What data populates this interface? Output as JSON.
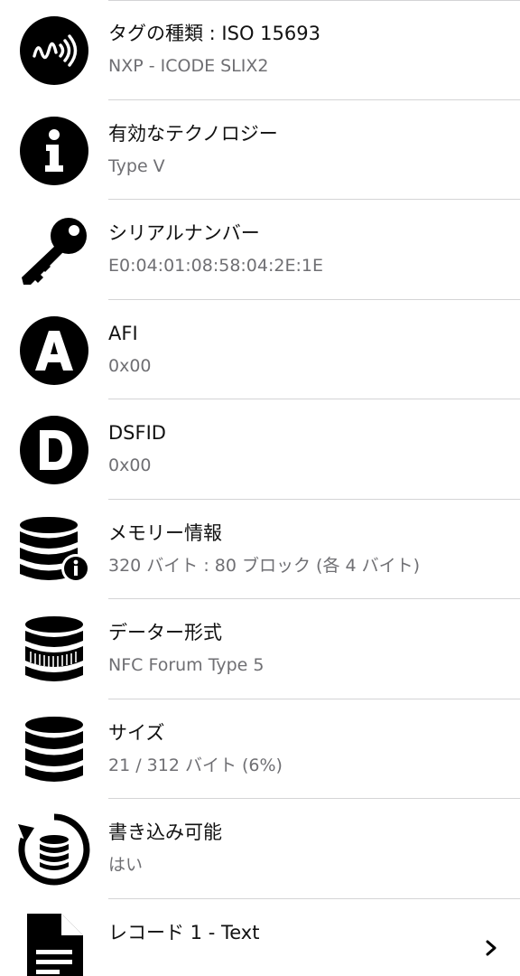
{
  "rows": [
    {
      "title": "タグの種類 : ISO 15693",
      "subtitle": "NXP - ICODE SLIX2",
      "icon": "nfc-wave-icon"
    },
    {
      "title": "有効なテクノロジー",
      "subtitle": "Type V",
      "icon": "info-icon"
    },
    {
      "title": "シリアルナンバー",
      "subtitle": "E0:04:01:08:58:04:2E:1E",
      "icon": "key-icon"
    },
    {
      "title": "AFI",
      "subtitle": "0x00",
      "icon": "letter-a-icon"
    },
    {
      "title": "DSFID",
      "subtitle": "0x00",
      "icon": "letter-d-icon"
    },
    {
      "title": "メモリー情報",
      "subtitle": "320 バイト : 80 ブロック (各 4 バイト)",
      "icon": "database-info-icon"
    },
    {
      "title": "データー形式",
      "subtitle": "NFC Forum Type 5",
      "icon": "database-format-icon"
    },
    {
      "title": "サイズ",
      "subtitle": "21 / 312 バイト (6%)",
      "icon": "database-icon"
    },
    {
      "title": "書き込み可能",
      "subtitle": "はい",
      "icon": "writable-database-icon"
    },
    {
      "title": "レコード 1 - Text",
      "subtitle": "",
      "icon": "document-icon",
      "chevron": "chevron-right-icon"
    }
  ],
  "colors": {
    "icon": "#000000",
    "title": "#111111",
    "subtitle": "#6f6f73",
    "separator": "#d4d4d6"
  }
}
